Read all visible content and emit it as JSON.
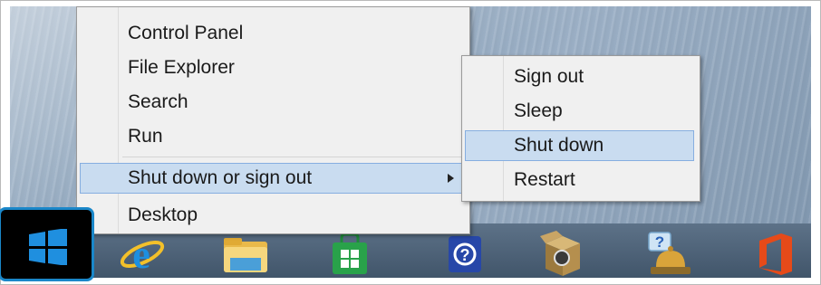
{
  "context_menu": {
    "items": [
      {
        "label": "Control Panel"
      },
      {
        "label": "File Explorer"
      },
      {
        "label": "Search"
      },
      {
        "label": "Run"
      },
      {
        "label": "Shut down or sign out"
      },
      {
        "label": "Desktop"
      }
    ]
  },
  "submenu": {
    "items": [
      {
        "label": "Sign out"
      },
      {
        "label": "Sleep"
      },
      {
        "label": "Shut down"
      },
      {
        "label": "Restart"
      }
    ]
  },
  "taskbar": {
    "start_button_icon": "windows-logo-icon",
    "pinned": [
      {
        "icon": "internet-explorer-icon"
      },
      {
        "icon": "file-explorer-icon"
      },
      {
        "icon": "store-icon"
      },
      {
        "icon": "help-icon"
      },
      {
        "icon": "package-box-icon"
      },
      {
        "icon": "help-desk-bell-icon"
      },
      {
        "icon": "office-icon"
      }
    ]
  },
  "colors": {
    "highlight": "#c9dcf0",
    "highlight_border": "#86aee0",
    "start_outline": "#1a87c9"
  }
}
